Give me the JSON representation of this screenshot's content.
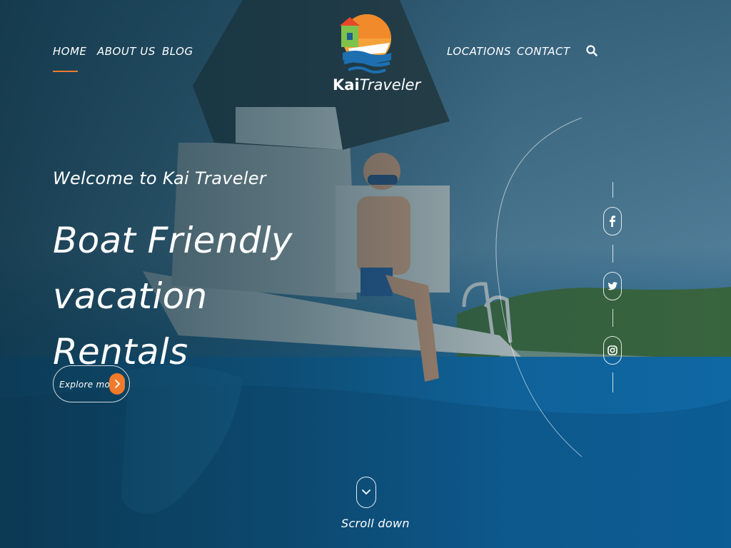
{
  "nav": {
    "left": [
      {
        "label": "HOME",
        "active": true
      },
      {
        "label": "ABOUT US"
      },
      {
        "label": "BLOG"
      }
    ],
    "right": [
      {
        "label": "LOCATIONS"
      },
      {
        "label": "CONTACT"
      }
    ],
    "search_icon": "search-icon"
  },
  "brand": {
    "name_bold": "Kai",
    "name_rest": "Traveler"
  },
  "hero": {
    "welcome": "Welcome to Kai Traveler",
    "headline_line1": "Boat Friendly vacation",
    "headline_line2": "Rentals",
    "cta_label": "Explore more",
    "scroll_label": "Scroll down"
  },
  "social": [
    {
      "icon": "facebook-icon"
    },
    {
      "icon": "twitter-icon"
    },
    {
      "icon": "instagram-icon"
    }
  ],
  "colors": {
    "accent": "#f07a2a",
    "overlay": "#0c3042",
    "water": "#0f73b8"
  }
}
